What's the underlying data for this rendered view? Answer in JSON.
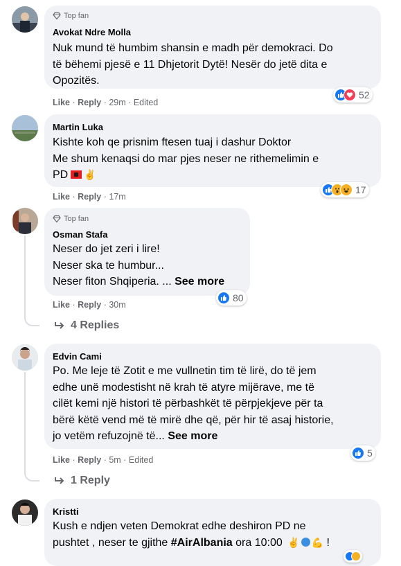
{
  "colors": {
    "bubble": "#f0f2f5",
    "meta": "#65676b",
    "like": "#1877f2",
    "love": "#f33e58",
    "haha": "#f7b125"
  },
  "comments": [
    {
      "badge": "Top fan",
      "author": "Avokat Ndre Molla",
      "lines": [
        "Nuk mund të humbim shansin e madh për demokraci. Do",
        "të bëhemi pjesë e 11 Dhjetorit Dytë! Nesër do jetë dita e",
        "Opozitës."
      ],
      "like": "Like",
      "reply": "Reply",
      "sep": "·",
      "time": "29m",
      "edited": "Edited",
      "reaction_count": "52",
      "reaction_icons": [
        "like-icon",
        "love-icon"
      ]
    },
    {
      "author": "Martin Luka",
      "lines": [
        "Kishte koh qe prisnim ftesen tuaj i dashur Doktor",
        "Me shum kenaqsi do mar pjes neser ne rithemelimin e",
        "PD"
      ],
      "like": "Like",
      "reply": "Reply",
      "sep": "·",
      "time": "17m",
      "reaction_count": "17",
      "reaction_icons": [
        "like-icon",
        "wow-icon",
        "haha-icon"
      ]
    },
    {
      "badge": "Top fan",
      "author": "Osman Stafa",
      "lines": [
        "Neser do jet zeri i lire!",
        "Neser ska te humbur...",
        "Neser fiton Shqiperia. ..."
      ],
      "see_more": "See more",
      "like": "Like",
      "reply": "Reply",
      "sep": "·",
      "time": "30m",
      "reaction_count": "80",
      "reaction_icons": [
        "like-icon"
      ],
      "replies": "4 Replies"
    },
    {
      "author": "Edvin Cami",
      "lines": [
        "Po. Me leje të Zotit e me vullnetin tim të lirë, do të jem",
        "edhe unë modestisht në krah të atyre mijërave, me të",
        "cilët kemi një histori të përbashkët të përpjekjeve për ta",
        "bërë këtë vend më të mirë dhe që, për hir të asaj historie,",
        "jo vetëm refuzojnë të..."
      ],
      "see_more": "See more",
      "like": "Like",
      "reply": "Reply",
      "sep": "·",
      "time": "5m",
      "edited": "Edited",
      "reaction_count": "5",
      "reaction_icons": [
        "like-icon"
      ],
      "replies": "1 Reply"
    },
    {
      "author": "Kristti",
      "lines": [
        "Kush e ndjen veten Demokrat edhe deshiron PD ne",
        "pushtet , neser te gjithe"
      ],
      "hashtag": "#AirAlbania",
      "line_tail": "ora 10:00",
      "exclaim": "!"
    }
  ]
}
